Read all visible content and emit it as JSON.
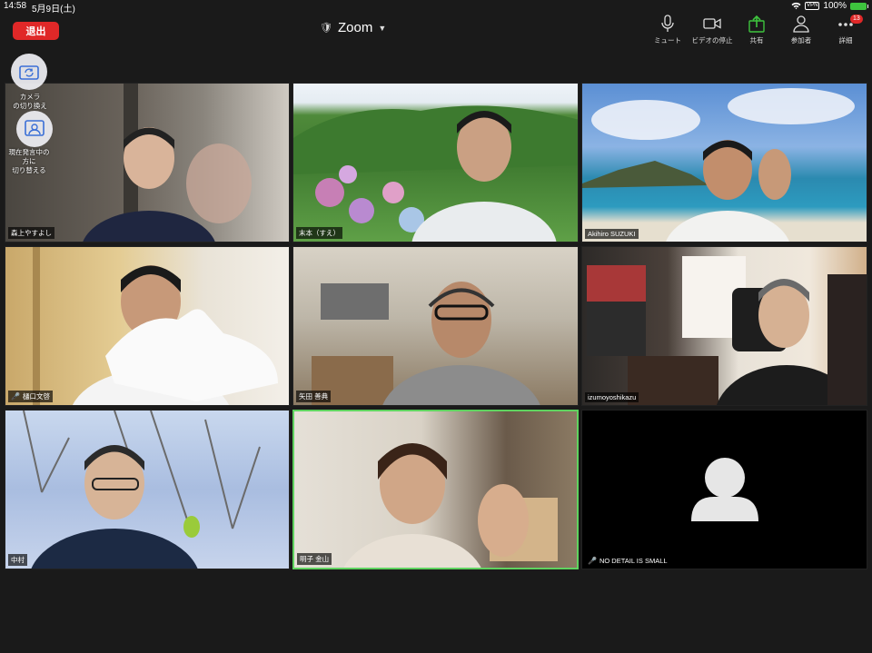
{
  "status": {
    "time": "14:58",
    "date": "5月9日(土)",
    "vpn": "VPN",
    "battery": "100%"
  },
  "header": {
    "leave_label": "退出",
    "title": "Zoom",
    "tools": [
      {
        "label": "ミュート",
        "icon": "microphone-icon"
      },
      {
        "label": "ビデオの停止",
        "icon": "video-camera-icon"
      },
      {
        "label": "共有",
        "icon": "share-icon"
      },
      {
        "label": "参加者",
        "icon": "participants-icon"
      },
      {
        "label": "詳細",
        "icon": "more-icon",
        "badge": "13"
      }
    ]
  },
  "side": {
    "switch_camera": "カメラ\nの切り換え",
    "switch_speaker": "現在発言中の\n方に\n切り替える"
  },
  "participants": [
    {
      "name": "森上やすよし",
      "muted": false
    },
    {
      "name": "末本（すえ）",
      "muted": false
    },
    {
      "name": "Akihiro SUZUKI",
      "muted": false
    },
    {
      "name": "樋口文啓",
      "muted": true
    },
    {
      "name": "矢田 善典",
      "muted": false
    },
    {
      "name": "izumoyoshikazu",
      "muted": false
    },
    {
      "name": "中村",
      "muted": false
    },
    {
      "name": "明子 金山",
      "muted": false,
      "active": true
    },
    {
      "name": "NO DETAIL IS SMALL",
      "muted": true,
      "video_off": true
    }
  ]
}
